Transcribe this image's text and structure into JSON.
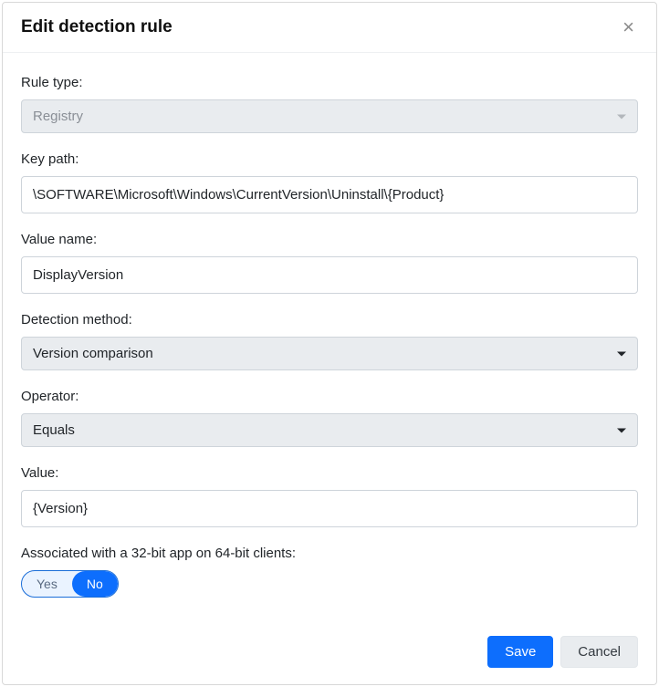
{
  "dialog": {
    "title": "Edit detection rule",
    "close_label": "×"
  },
  "form": {
    "rule_type": {
      "label": "Rule type:",
      "value": "Registry"
    },
    "key_path": {
      "label": "Key path:",
      "value": "\\SOFTWARE\\Microsoft\\Windows\\CurrentVersion\\Uninstall\\{Product}"
    },
    "value_name": {
      "label": "Value name:",
      "value": "DisplayVersion"
    },
    "detection_method": {
      "label": "Detection method:",
      "value": "Version comparison"
    },
    "operator": {
      "label": "Operator:",
      "value": "Equals"
    },
    "value": {
      "label": "Value:",
      "value": "{Version}"
    },
    "assoc_32bit": {
      "label": "Associated with a 32-bit app on 64-bit clients:",
      "option_yes": "Yes",
      "option_no": "No",
      "selected": "No"
    }
  },
  "actions": {
    "save": "Save",
    "cancel": "Cancel"
  }
}
